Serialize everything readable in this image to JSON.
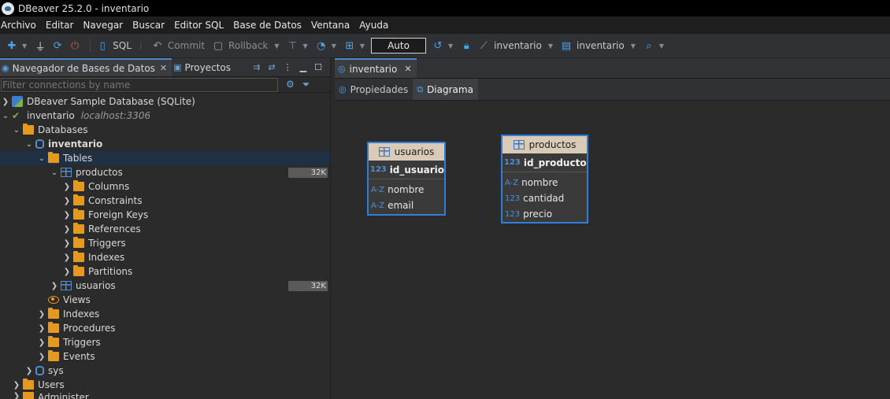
{
  "window": {
    "title": "DBeaver 25.2.0 - inventario"
  },
  "menu": [
    "Archivo",
    "Editar",
    "Navegar",
    "Buscar",
    "Editor SQL",
    "Base de Datos",
    "Ventana",
    "Ayuda"
  ],
  "toolbar": {
    "sql_label": "SQL",
    "commit_label": "Commit",
    "rollback_label": "Rollback",
    "mode_value": "Auto",
    "datasource_label": "inventario",
    "schema_label": "inventario"
  },
  "navigator": {
    "tab_label": "Navegador de Bases de Datos",
    "projects_tab_label": "Proyectos",
    "filter_placeholder": "Filter connections by name",
    "tree": {
      "sample_db": "DBeaver Sample Database (SQLite)",
      "connection": "inventario",
      "connection_host": "localhost:3306",
      "databases": "Databases",
      "schema": "inventario",
      "tables": "Tables",
      "table_productos": "productos",
      "productos_size": "32K",
      "columns": "Columns",
      "constraints": "Constraints",
      "foreign_keys": "Foreign Keys",
      "references": "References",
      "triggers": "Triggers",
      "indexes": "Indexes",
      "partitions": "Partitions",
      "table_usuarios": "usuarios",
      "usuarios_size": "32K",
      "views": "Views",
      "schema_indexes": "Indexes",
      "procedures": "Procedures",
      "schema_triggers": "Triggers",
      "events": "Events",
      "sys": "sys",
      "users": "Users",
      "administer": "Administer"
    }
  },
  "editor": {
    "tab_label": "inventario",
    "subtabs": {
      "properties": "Propiedades",
      "diagram": "Diagrama"
    }
  },
  "diagram": {
    "usuarios": {
      "name": "usuarios",
      "pk_type": "123",
      "pk": "id_usuario",
      "columns": [
        {
          "type": "A-Z",
          "name": "nombre"
        },
        {
          "type": "A-Z",
          "name": "email"
        }
      ]
    },
    "productos": {
      "name": "productos",
      "pk_type": "123",
      "pk": "id_producto",
      "columns": [
        {
          "type": "A-Z",
          "name": "nombre"
        },
        {
          "type": "123",
          "name": "cantidad"
        },
        {
          "type": "123",
          "name": "precio"
        }
      ]
    }
  }
}
